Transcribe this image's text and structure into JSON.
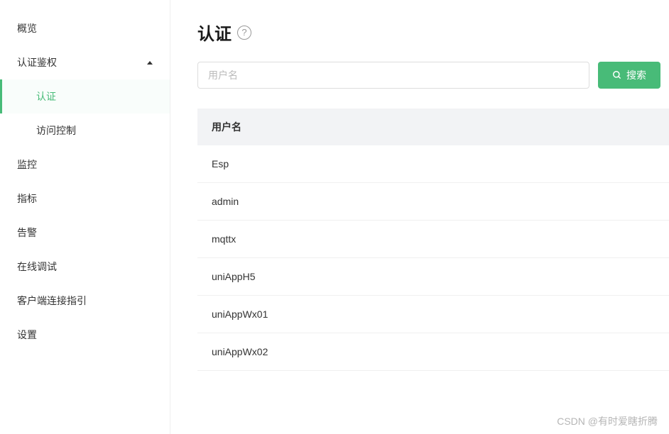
{
  "sidebar": {
    "items": [
      {
        "label": "概览",
        "type": "item"
      },
      {
        "label": "认证鉴权",
        "type": "submenu",
        "expanded": true,
        "children": [
          {
            "label": "认证",
            "active": true
          },
          {
            "label": "访问控制",
            "active": false
          }
        ]
      },
      {
        "label": "监控",
        "type": "item"
      },
      {
        "label": "指标",
        "type": "item"
      },
      {
        "label": "告警",
        "type": "item"
      },
      {
        "label": "在线调试",
        "type": "item"
      },
      {
        "label": "客户端连接指引",
        "type": "item"
      },
      {
        "label": "设置",
        "type": "item"
      }
    ]
  },
  "page": {
    "title": "认证"
  },
  "search": {
    "placeholder": "用户名",
    "button_label": "搜索"
  },
  "table": {
    "header": "用户名",
    "rows": [
      "Esp",
      "admin",
      "mqttx",
      "uniAppH5",
      "uniAppWx01",
      "uniAppWx02"
    ]
  },
  "watermark": "CSDN @有时爱瞎折腾"
}
